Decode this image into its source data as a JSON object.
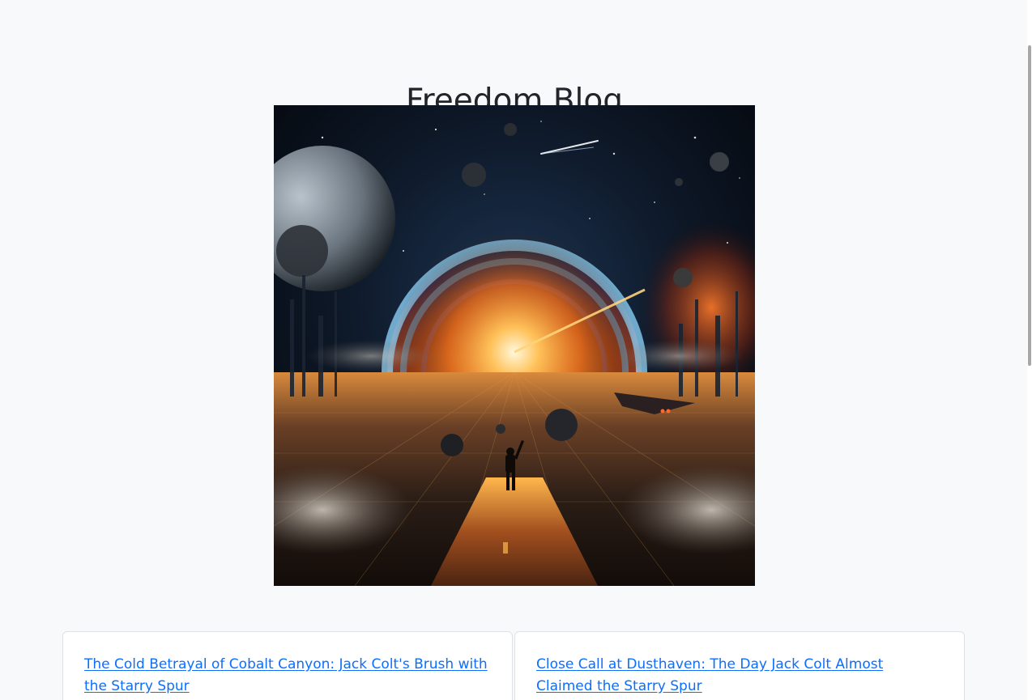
{
  "blog": {
    "title": "Freedom Blog"
  },
  "hero_image": {
    "description_icon": "space-gateway-artwork"
  },
  "posts": [
    {
      "title": "The Cold Betrayal of Cobalt Canyon: Jack Colt's Brush with the Starry Spur"
    },
    {
      "title": "Close Call at Dusthaven: The Day Jack Colt Almost Claimed the Starry Spur"
    }
  ],
  "colors": {
    "link": "#0d6efd",
    "background": "#f8f9fa",
    "card_border": "#dee2e6"
  }
}
